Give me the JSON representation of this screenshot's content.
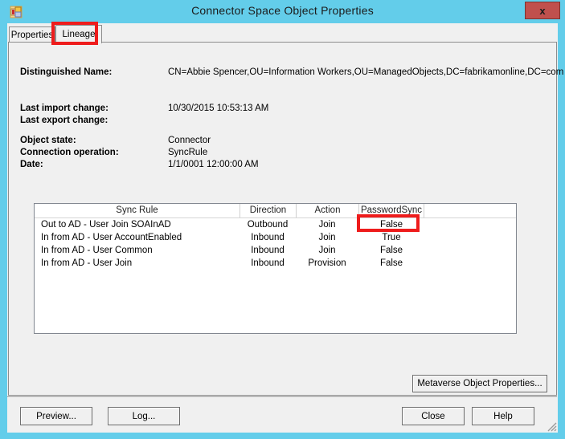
{
  "window": {
    "title": "Connector Space Object Properties",
    "app_icon": "miis-object-icon",
    "close_label": "x"
  },
  "tabs": [
    {
      "label": "Properties",
      "selected": false
    },
    {
      "label": "Lineage",
      "selected": true
    }
  ],
  "details": {
    "distinguished_name_label": "Distinguished Name:",
    "distinguished_name_value": "CN=Abbie Spencer,OU=Information Workers,OU=ManagedObjects,DC=fabrikamonline,DC=com",
    "last_import_change_label": "Last import change:",
    "last_import_change_value": "10/30/2015 10:53:13 AM",
    "last_export_change_label": "Last export change:",
    "last_export_change_value": "",
    "object_state_label": "Object state:",
    "object_state_value": "Connector",
    "connection_operation_label": "Connection operation:",
    "connection_operation_value": "SyncRule",
    "date_label": "Date:",
    "date_value": "1/1/0001 12:00:00 AM"
  },
  "grid": {
    "columns": [
      "Sync Rule",
      "Direction",
      "Action",
      "PasswordSync"
    ],
    "rows": [
      {
        "rule": "Out to AD - User Join SOAInAD",
        "direction": "Outbound",
        "action": "Join",
        "password_sync": "False"
      },
      {
        "rule": "In from AD - User AccountEnabled",
        "direction": "Inbound",
        "action": "Join",
        "password_sync": "True"
      },
      {
        "rule": "In from AD - User Common",
        "direction": "Inbound",
        "action": "Join",
        "password_sync": "False"
      },
      {
        "rule": "In from AD - User Join",
        "direction": "Inbound",
        "action": "Provision",
        "password_sync": "False"
      }
    ]
  },
  "buttons": {
    "metaverse_object_properties": "Metaverse Object Properties...",
    "preview": "Preview...",
    "log": "Log...",
    "close": "Close",
    "help": "Help"
  },
  "annotations": {
    "color": "#ee1c1c",
    "targets": [
      "tab-lineage",
      "grid-cell-passwordsync-row2"
    ]
  }
}
